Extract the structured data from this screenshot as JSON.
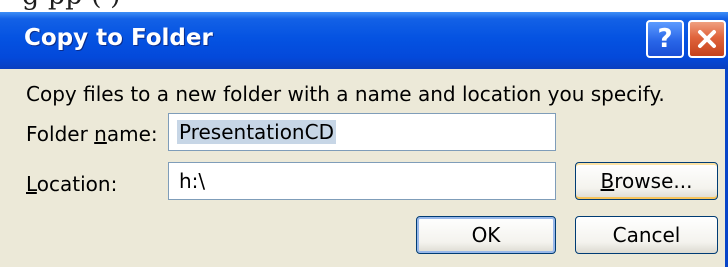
{
  "background": {
    "heading_fragment": "g    pp  (              )"
  },
  "dialog": {
    "title": "Copy to Folder",
    "help_glyph": "?",
    "close_icon": "close-x",
    "description": "Copy files to a new folder with a name and location you specify.",
    "folder_name": {
      "label_before": "Folder ",
      "label_accel": "n",
      "label_after": "ame:",
      "value": "PresentationCD"
    },
    "location": {
      "label_before": "",
      "label_accel": "L",
      "label_after": "ocation:",
      "value": "h:\\"
    },
    "buttons": {
      "browse": {
        "accel": "B",
        "rest": "rowse..."
      },
      "ok": "OK",
      "cancel": "Cancel"
    },
    "colors": {
      "titlebar": "#0553e2",
      "face": "#ece9d8",
      "field_border": "#7f9db9",
      "close": "#e0643c"
    }
  }
}
